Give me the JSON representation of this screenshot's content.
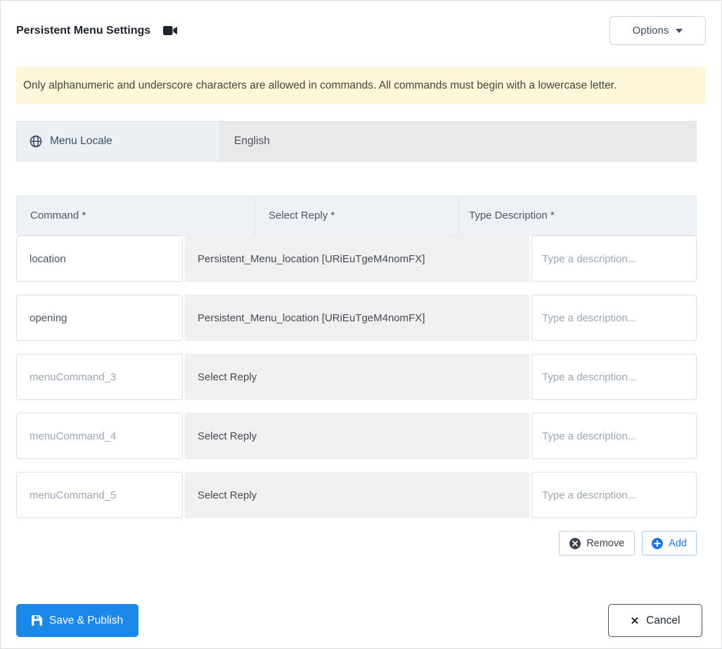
{
  "header": {
    "title": "Persistent Menu Settings",
    "options_label": "Options"
  },
  "alert": {
    "text": "Only alphanumeric and underscore characters are allowed in commands. All commands must begin with a lowercase letter."
  },
  "locale": {
    "label": "Menu Locale",
    "value": "English"
  },
  "table": {
    "headers": {
      "command": "Command *",
      "reply": "Select Reply *",
      "description": "Type Description *"
    },
    "description_placeholder": "Type a description...",
    "rows": [
      {
        "command": "location",
        "command_filled": true,
        "reply": "Persistent_Menu_location [URiEuTgeM4nomFX]"
      },
      {
        "command": "opening",
        "command_filled": true,
        "reply": "Persistent_Menu_location [URiEuTgeM4nomFX]"
      },
      {
        "command": "menuCommand_3",
        "command_filled": false,
        "reply": "Select Reply"
      },
      {
        "command": "menuCommand_4",
        "command_filled": false,
        "reply": "Select Reply"
      },
      {
        "command": "menuCommand_5",
        "command_filled": false,
        "reply": "Select Reply"
      }
    ],
    "remove_label": "Remove",
    "add_label": "Add"
  },
  "footer": {
    "save_label": "Save & Publish",
    "cancel_label": "Cancel",
    "cancel_icon": "✕"
  },
  "colors": {
    "primary_blue": "#1b87e8",
    "add_blue": "#1b76dd",
    "alert_bg": "#fdf6d8",
    "header_bg": "#eef2f7",
    "reply_bg": "#f0f0f0",
    "locale_left_bg": "#eceff3",
    "locale_right_bg": "#e9e9e9",
    "dark_slate": "#3a434d"
  }
}
